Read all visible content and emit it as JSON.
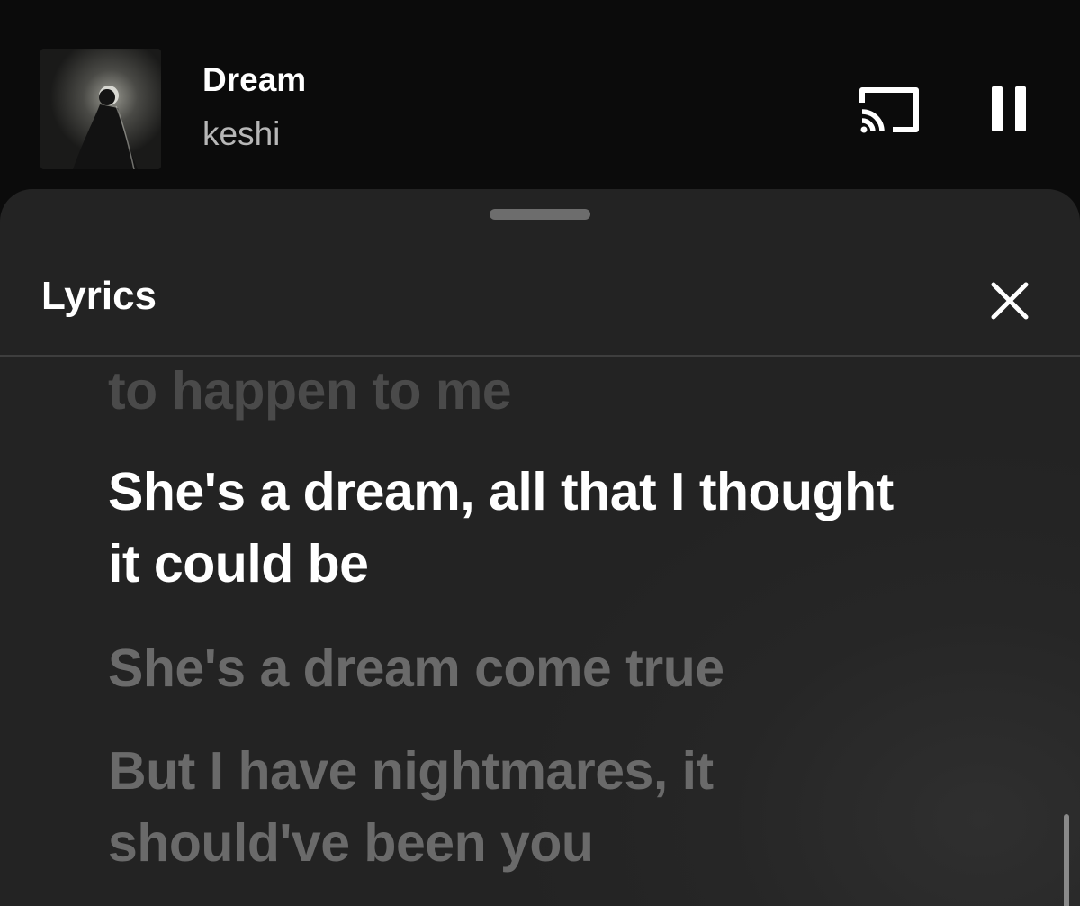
{
  "mini_player": {
    "track_title": "Dream",
    "artist": "keshi",
    "album_art_icon": "album-art-silhouette",
    "cast_icon": "cast-icon",
    "pause_icon": "pause-icon"
  },
  "lyrics_sheet": {
    "title": "Lyrics",
    "close_icon": "close-icon",
    "lines": [
      {
        "text": "to happen to me",
        "state": "past"
      },
      {
        "text": "She's a dream, all that I thought it could be",
        "state": "active"
      },
      {
        "text": "She's a dream come true",
        "state": "upcoming"
      },
      {
        "text": "But I have nightmares, it should've been you",
        "state": "upcoming"
      }
    ]
  },
  "colors": {
    "background": "#0b0b0b",
    "sheet": "#262626",
    "active_lyric": "#ffffff",
    "upcoming_lyric": "#6a6a6a",
    "past_lyric": "#4a4a4a",
    "artist_text": "#b7b7b7"
  }
}
